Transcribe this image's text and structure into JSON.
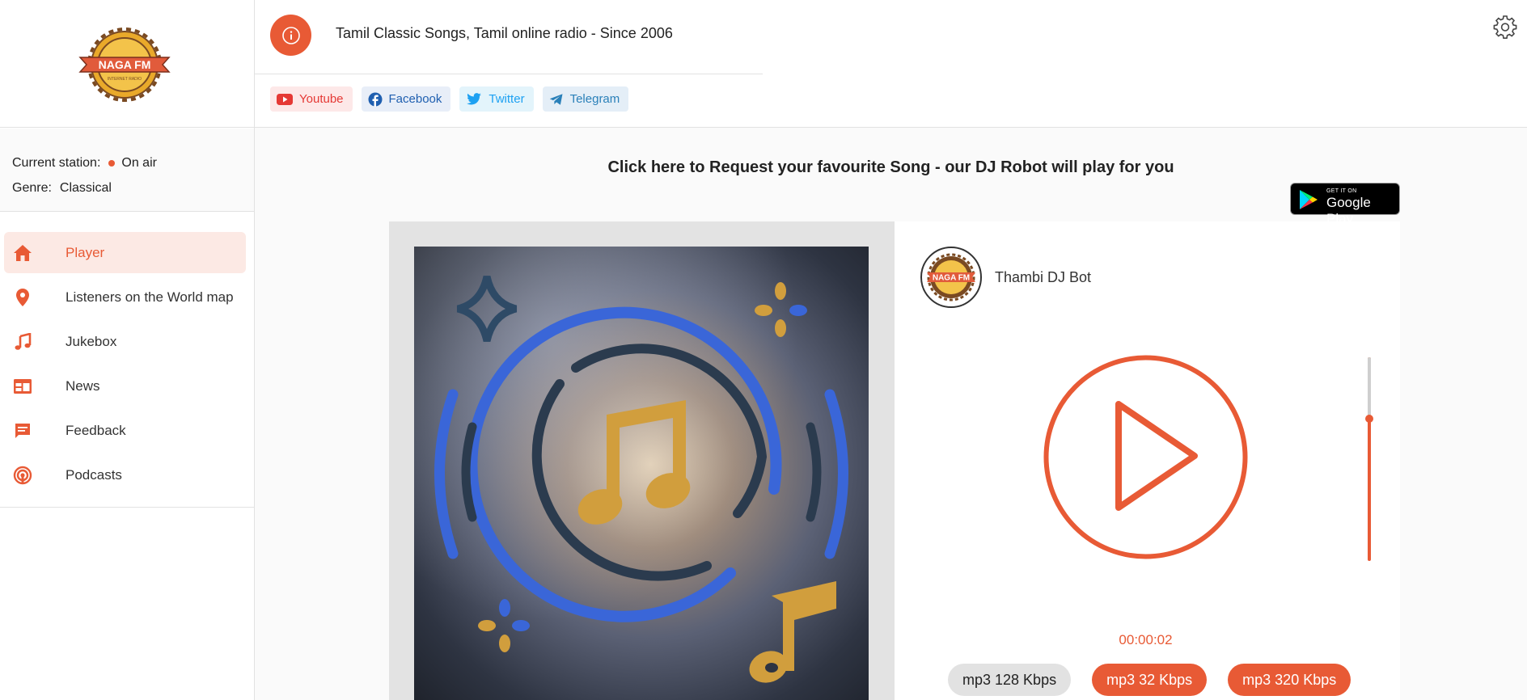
{
  "brand": {
    "logo_text": "NAGA FM",
    "logo_subtext": "INTERNET RADIO",
    "accent_color": "#e85a35"
  },
  "header": {
    "tagline": "Tamil Classic Songs, Tamil online radio - Since 2006",
    "socials": [
      {
        "label": "Youtube",
        "icon": "youtube-icon"
      },
      {
        "label": "Facebook",
        "icon": "facebook-icon"
      },
      {
        "label": "Twitter",
        "icon": "twitter-icon"
      },
      {
        "label": "Telegram",
        "icon": "telegram-icon"
      }
    ]
  },
  "station": {
    "current_label": "Current station:",
    "status": "On air",
    "genre_label": "Genre:",
    "genre": "Classical"
  },
  "nav": {
    "items": [
      {
        "label": "Player",
        "icon": "home-icon",
        "active": true
      },
      {
        "label": "Listeners on the World map",
        "icon": "map-pin-icon",
        "active": false
      },
      {
        "label": "Jukebox",
        "icon": "music-note-icon",
        "active": false
      },
      {
        "label": "News",
        "icon": "news-icon",
        "active": false
      },
      {
        "label": "Feedback",
        "icon": "feedback-icon",
        "active": false
      },
      {
        "label": "Podcasts",
        "icon": "podcast-icon",
        "active": false
      }
    ]
  },
  "main": {
    "request_text": "Click here to Request your favourite Song - our DJ Robot will play for you",
    "google_play": {
      "small": "GET IT ON",
      "big": "Google Play"
    }
  },
  "player": {
    "dj_name": "Thambi DJ Bot",
    "elapsed": "00:00:02",
    "volume_level": 0.7,
    "bitrates": [
      {
        "label": "mp3 128 Kbps",
        "selected": false
      },
      {
        "label": "mp3 32 Kbps",
        "selected": true
      },
      {
        "label": "mp3 320 Kbps",
        "selected": true
      }
    ]
  }
}
